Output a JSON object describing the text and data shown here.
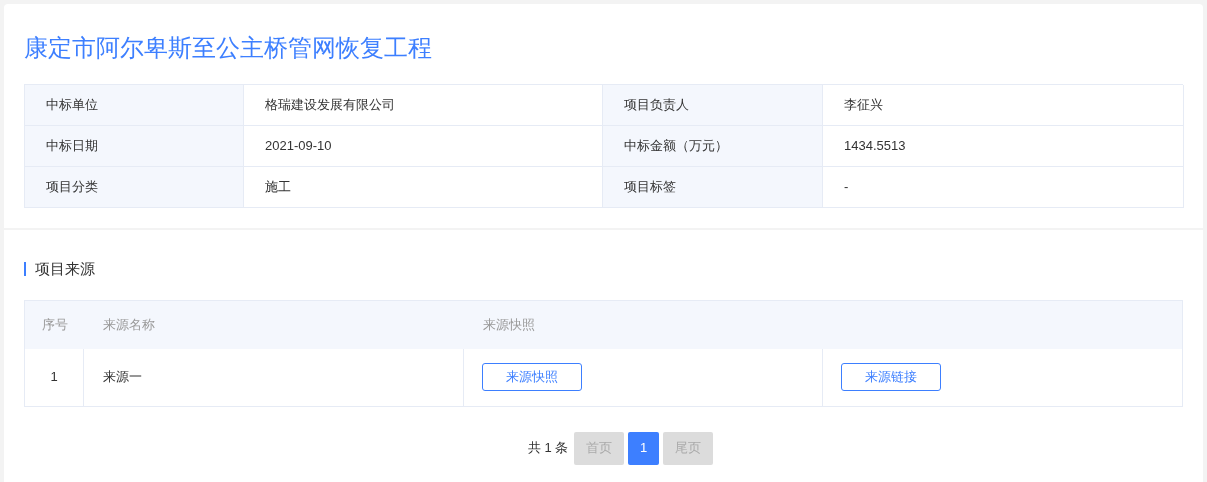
{
  "title": "康定市阿尔卑斯至公主桥管网恢复工程",
  "info": [
    {
      "label": "中标单位",
      "value": "格瑞建设发展有限公司"
    },
    {
      "label": "项目负责人",
      "value": "李征兴"
    },
    {
      "label": "中标日期",
      "value": "2021-09-10"
    },
    {
      "label": "中标金额（万元）",
      "value": "1434.5513"
    },
    {
      "label": "项目分类",
      "value": "施工"
    },
    {
      "label": "项目标签",
      "value": "-"
    }
  ],
  "section": {
    "heading": "项目来源",
    "table": {
      "columns": [
        "序号",
        "来源名称",
        "来源快照"
      ],
      "rows": [
        {
          "index": "1",
          "name": "来源一",
          "snapshot_button": "来源快照",
          "link_button": "来源链接"
        }
      ]
    }
  },
  "pagination": {
    "total": "共 1 条",
    "first": {
      "label": "首页",
      "disabled": true
    },
    "pages": [
      {
        "label": "1",
        "selected": true
      }
    ],
    "last": {
      "label": "尾页",
      "disabled": true
    }
  }
}
